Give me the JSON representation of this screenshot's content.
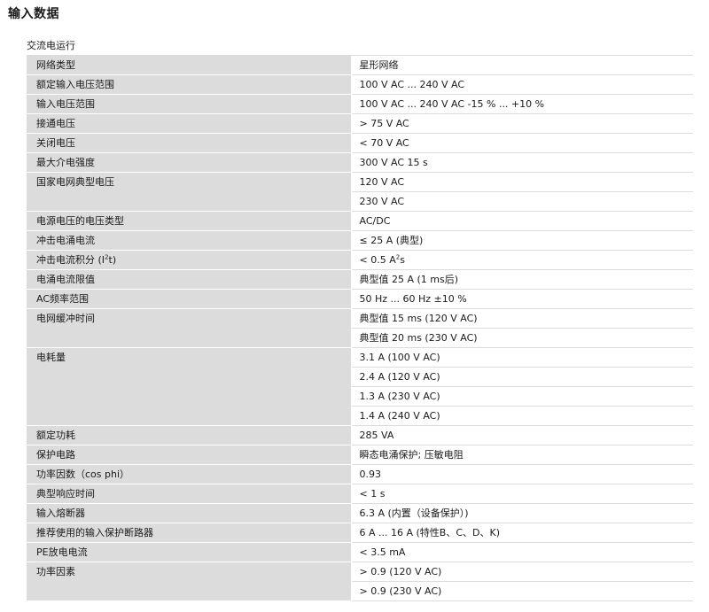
{
  "page_title": "输入数据",
  "section_title": "交流电运行",
  "rows": [
    {
      "label": "网络类型",
      "values": [
        "星形网络"
      ]
    },
    {
      "label": "额定输入电压范围",
      "values": [
        "100 V AC ... 240 V AC"
      ]
    },
    {
      "label": "输入电压范围",
      "values": [
        "100 V AC ... 240 V AC -15 % ... +10 %"
      ]
    },
    {
      "label": "接通电压",
      "values": [
        "> 75 V AC"
      ]
    },
    {
      "label": "关闭电压",
      "values": [
        "< 70 V AC"
      ]
    },
    {
      "label": "最大介电强度",
      "values": [
        "300 V AC 15 s"
      ]
    },
    {
      "label": "国家电网典型电压",
      "values": [
        "120 V AC",
        "230 V AC"
      ]
    },
    {
      "label": "电源电压的电压类型",
      "values": [
        "AC/DC"
      ]
    },
    {
      "label": "冲击电涌电流",
      "values": [
        "≤ 25 A (典型)"
      ]
    },
    {
      "label_parts": [
        "冲击电流积分 (I",
        "2",
        "t)"
      ],
      "value_parts": [
        "< 0.5 A",
        "2",
        "s"
      ]
    },
    {
      "label": "电涌电流限值",
      "values": [
        "典型值 25 A (1 ms后)"
      ]
    },
    {
      "label": "AC频率范围",
      "values": [
        "50 Hz ... 60 Hz ±10 %"
      ]
    },
    {
      "label": "电网缓冲时间",
      "values": [
        "典型值 15 ms (120 V AC)",
        "典型值 20 ms (230 V AC)"
      ]
    },
    {
      "label": "电耗量",
      "values": [
        "3.1 A (100 V AC)",
        "2.4 A (120 V AC)",
        "1.3 A (230 V AC)",
        "1.4 A (240 V AC)"
      ]
    },
    {
      "label": "额定功耗",
      "values": [
        "285 VA"
      ]
    },
    {
      "label": "保护电路",
      "values": [
        "瞬态电涌保护; 压敏电阻"
      ]
    },
    {
      "label": "功率因数（cos phi）",
      "values": [
        "0.93"
      ]
    },
    {
      "label": "典型响应时间",
      "values": [
        "< 1 s"
      ]
    },
    {
      "label": "输入熔断器",
      "values": [
        "6.3 A (内置（设备保护）)"
      ]
    },
    {
      "label": "推荐使用的输入保护断路器",
      "values": [
        "6 A ... 16 A (特性B、C、D、K)"
      ]
    },
    {
      "label": "PE放电电流",
      "values": [
        "< 3.5 mA"
      ]
    },
    {
      "label": "功率因素",
      "values": [
        "> 0.9 (120 V AC)",
        "> 0.9 (230 V AC)"
      ]
    }
  ]
}
